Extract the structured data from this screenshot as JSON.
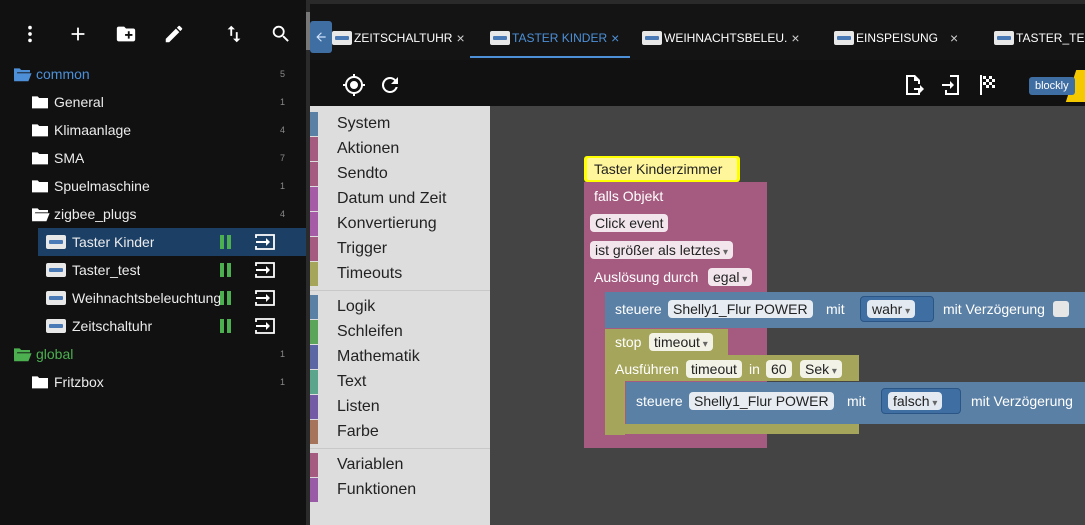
{
  "sidebar": {
    "toolbar": {
      "menu_icon": "more-vert-icon",
      "add_icon": "add-icon",
      "folder_add_icon": "create-new-folder-icon",
      "edit_icon": "edit-icon",
      "sort_icon": "swap-vert-icon",
      "search_icon": "search-icon"
    },
    "tree": [
      {
        "label": "common",
        "count": "5",
        "type": "folder-open",
        "color": "#4d90d8"
      },
      {
        "label": "General",
        "count": "1",
        "type": "folder"
      },
      {
        "label": "Klimaanlage",
        "count": "4",
        "type": "folder"
      },
      {
        "label": "SMA",
        "count": "7",
        "type": "folder"
      },
      {
        "label": "Spuelmaschine",
        "count": "1",
        "type": "folder"
      },
      {
        "label": "zigbee_plugs",
        "count": "4",
        "type": "folder-open"
      },
      {
        "label": "Taster Kinder",
        "type": "script",
        "selected": true
      },
      {
        "label": "Taster_test",
        "type": "script"
      },
      {
        "label": "Weihnachtsbeleuchtung",
        "type": "script"
      },
      {
        "label": "Zeitschaltuhr",
        "type": "script"
      },
      {
        "label": "global",
        "count": "1",
        "type": "folder-open",
        "color": "#4caf50"
      },
      {
        "label": "Fritzbox",
        "count": "1",
        "type": "folder"
      }
    ]
  },
  "tabs": [
    {
      "label": "ZEITSCHALTUHR",
      "close": "×"
    },
    {
      "label": "TASTER KINDER",
      "close": "×",
      "active": true
    },
    {
      "label": "WEIHNACHTSBELEU.",
      "close": "×"
    },
    {
      "label": "EINSPEISUNG",
      "close": "×"
    },
    {
      "label": "TASTER_TE",
      "close": ""
    }
  ],
  "editor_toolbar": {
    "locate_icon": "gps-fixed-icon",
    "refresh_icon": "refresh-icon",
    "export_icon": "export-icon",
    "import_icon": "import-icon",
    "check_icon": "checkered-flag-icon",
    "mode_label": "blockly"
  },
  "toolbox": {
    "groups": [
      [
        {
          "label": "System",
          "color": "#5b80a5"
        },
        {
          "label": "Aktionen",
          "color": "#a55b80"
        },
        {
          "label": "Sendto",
          "color": "#a55b80"
        },
        {
          "label": "Datum und Zeit",
          "color": "#a55ba5"
        },
        {
          "label": "Konvertierung",
          "color": "#a55ba5"
        },
        {
          "label": "Trigger",
          "color": "#a55b80"
        },
        {
          "label": "Timeouts",
          "color": "#a5a55b"
        }
      ],
      [
        {
          "label": "Logik",
          "color": "#5b80a5"
        },
        {
          "label": "Schleifen",
          "color": "#5ba55b"
        },
        {
          "label": "Mathematik",
          "color": "#5b67a5"
        },
        {
          "label": "Text",
          "color": "#5ba58c"
        },
        {
          "label": "Listen",
          "color": "#745ba5"
        },
        {
          "label": "Farbe",
          "color": "#a5745b"
        }
      ],
      [
        {
          "label": "Variablen",
          "color": "#a55b80"
        },
        {
          "label": "Funktionen",
          "color": "#995ba5"
        }
      ]
    ]
  },
  "blocks": {
    "comment": "Taster Kinderzimmer",
    "trigger": {
      "label": "falls Objekt",
      "event": "Click event",
      "condition": "ist größer als letztes",
      "trigger_label": "Auslösung durch",
      "trigger_value": "egal"
    },
    "set1": {
      "prefix": "steuere",
      "object": "Shelly1_Flur POWER",
      "with": "mit",
      "value": "wahr",
      "delay": "mit Verzögerung"
    },
    "stop": {
      "label": "stop",
      "value": "timeout"
    },
    "timeout": {
      "label": "Ausführen",
      "name": "timeout",
      "in": "in",
      "amount": "60",
      "unit": "Sek"
    },
    "set2": {
      "prefix": "steuere",
      "object": "Shelly1_Flur POWER",
      "with": "mit",
      "value": "falsch",
      "delay": "mit Verzögerung"
    }
  },
  "colors": {
    "accent": "#4d90d8",
    "event_block": "#a55b80",
    "control_block": "#5b80a5",
    "timeout_block": "#a5a55b",
    "comment": "#ffff00"
  }
}
